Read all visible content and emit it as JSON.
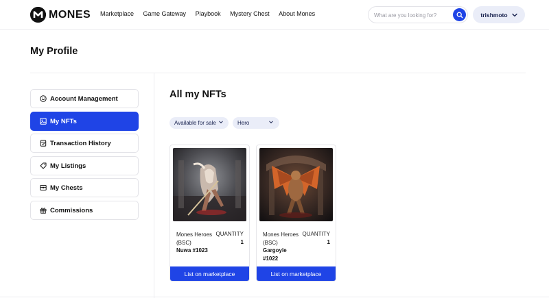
{
  "brand": {
    "name": "MONES"
  },
  "nav": {
    "items": [
      {
        "label": "Marketplace"
      },
      {
        "label": "Game Gateway"
      },
      {
        "label": "Playbook"
      },
      {
        "label": "Mystery Chest"
      },
      {
        "label": "About Mones"
      }
    ]
  },
  "search": {
    "placeholder": "What are you looking for?",
    "value": ""
  },
  "user": {
    "name": "trishmoto"
  },
  "page": {
    "title": "My Profile"
  },
  "sidebar": {
    "items": [
      {
        "label": "Account Management",
        "icon": "smiley-icon",
        "active": false
      },
      {
        "label": "My NFTs",
        "icon": "image-icon",
        "active": true
      },
      {
        "label": "Transaction History",
        "icon": "receipt-icon",
        "active": false
      },
      {
        "label": "My Listings",
        "icon": "tag-icon",
        "active": false
      },
      {
        "label": "My Chests",
        "icon": "chest-icon",
        "active": false
      },
      {
        "label": "Commissions",
        "icon": "gift-icon",
        "active": false
      }
    ]
  },
  "main": {
    "title": "All my NFTs",
    "filters": [
      {
        "label": "Available for sale"
      },
      {
        "label": "Hero"
      }
    ],
    "cards": [
      {
        "collection": "Mones Heroes (BSC)",
        "quantity_label": "QUANTITY",
        "quantity": "1",
        "name": "Nuwa #1023",
        "button": "List on marketplace"
      },
      {
        "collection": "Mones Heroes (BSC)",
        "quantity_label": "QUANTITY",
        "quantity": "1",
        "name": "Gargoyle #1022",
        "button": "List on marketplace"
      }
    ]
  },
  "colors": {
    "accent": "#1f44e6",
    "pill_bg": "#eaedf8",
    "text": "#111111",
    "border": "#e3e3e8"
  }
}
